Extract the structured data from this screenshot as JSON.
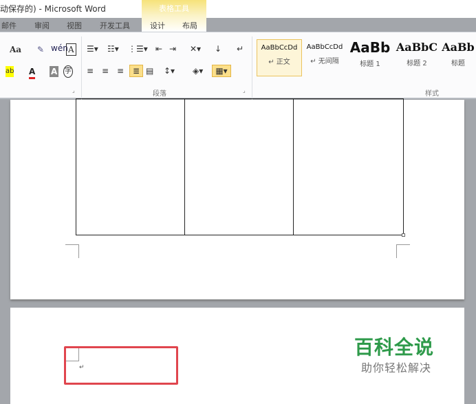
{
  "window": {
    "title": "动保存的) - Microsoft Word",
    "context_tab_group": "表格工具"
  },
  "tabs": [
    "邮件",
    "审阅",
    "视图",
    "开发工具",
    "设计",
    "布局"
  ],
  "ribbon": {
    "groups": {
      "paragraph": "段落",
      "styles": "样式"
    },
    "styles": [
      {
        "preview": "AaBbCcDd",
        "label": "↵ 正文"
      },
      {
        "preview": "AaBbCcDd",
        "label": "↵ 无间隔"
      },
      {
        "preview": "AaBb",
        "label": "标题 1"
      },
      {
        "preview": "AaBbC",
        "label": "标题 2"
      },
      {
        "preview": "AaBb",
        "label": "标题"
      }
    ],
    "font_icons": {
      "change_case": "Aa",
      "phonetic": "wén",
      "char_border": "A",
      "highlight": "ab",
      "font_color": "A",
      "char_shading": "A",
      "enclose": "字"
    }
  },
  "document": {
    "paragraph_mark": "↵"
  },
  "watermark": {
    "title": "百科全说",
    "subtitle": "助你轻松解决"
  },
  "colors": {
    "accent_red": "#e0454e",
    "watermark_green": "#2e9a4a",
    "context_tab": "#f6e27a"
  }
}
